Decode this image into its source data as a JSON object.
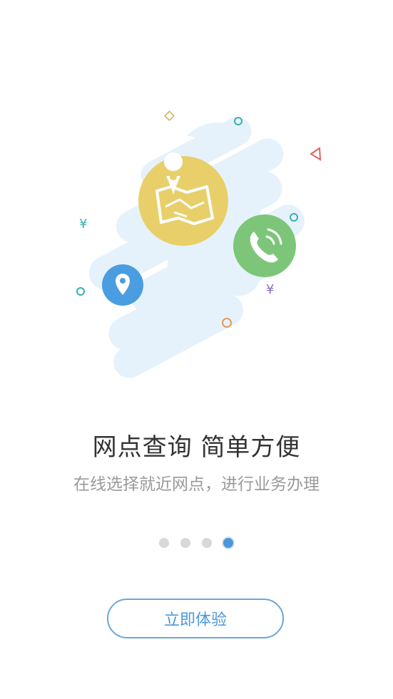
{
  "screen": {
    "title": "网点查询  简单方便",
    "subtitle": "在线选择就近网点，进行业务办理",
    "cta_label": "立即体验"
  },
  "pagination": {
    "total": 4,
    "active_index": 4
  },
  "illustration": {
    "icons": [
      "map-icon",
      "phone-icon",
      "location-pin-icon"
    ],
    "decor_symbols": [
      "¥",
      "¥"
    ]
  },
  "colors": {
    "accent": "#4c97d8",
    "map_circle": "#e8cf6a",
    "phone_circle": "#7dc679",
    "pin_circle": "#4a9de0",
    "cloud": "#e4f1fb"
  }
}
